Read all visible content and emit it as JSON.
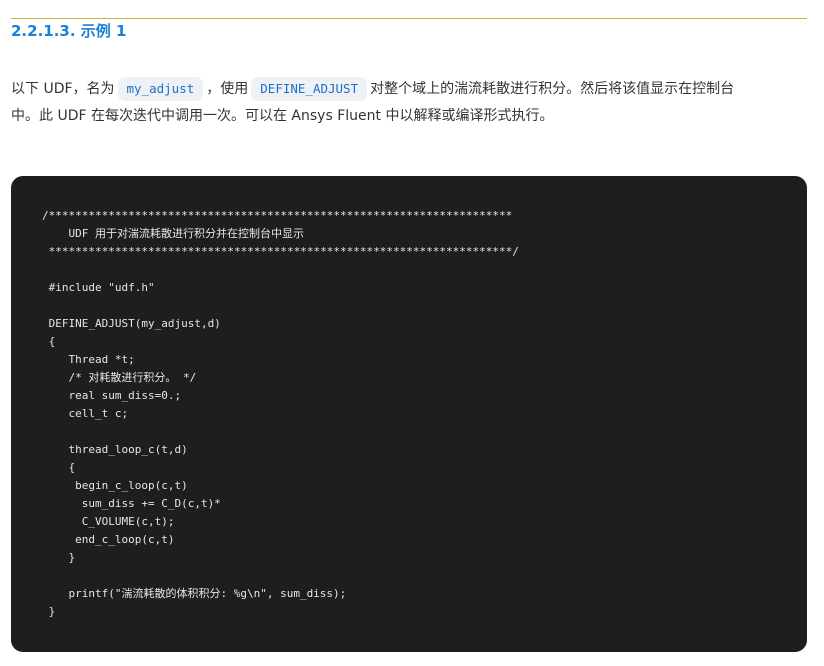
{
  "heading": {
    "number": "2.2.1.3.",
    "title": "示例 1"
  },
  "paragraph": {
    "segment1": "以下 UDF，名为",
    "code1": "my_adjust",
    "segment2": "，使用",
    "code2": "DEFINE_ADJUST",
    "segment3": "对整个域上的湍流耗散进行积分。然后将该值显示在控制台",
    "line2": "中。此 UDF 在每次迭代中调用一次。可以在 Ansys Fluent 中以解释或编译形式执行。"
  },
  "code": {
    "lines": [
      "/**********************************************************************",
      "    UDF 用于对湍流耗散进行积分并在控制台中显示",
      " **********************************************************************/",
      "",
      " #include \"udf.h\"",
      "",
      " DEFINE_ADJUST(my_adjust,d)",
      " {",
      "    Thread *t;",
      "    /* 对耗散进行积分。 */",
      "    real sum_diss=0.;",
      "    cell_t c;",
      "",
      "    thread_loop_c(t,d)",
      "    {",
      "     begin_c_loop(c,t)",
      "      sum_diss += C_D(c,t)*",
      "      C_VOLUME(c,t);",
      "     end_c_loop(c,t)",
      "    }",
      "",
      "    printf(\"湍流耗散的体积积分: %g\\n\", sum_diss);",
      " }"
    ]
  }
}
